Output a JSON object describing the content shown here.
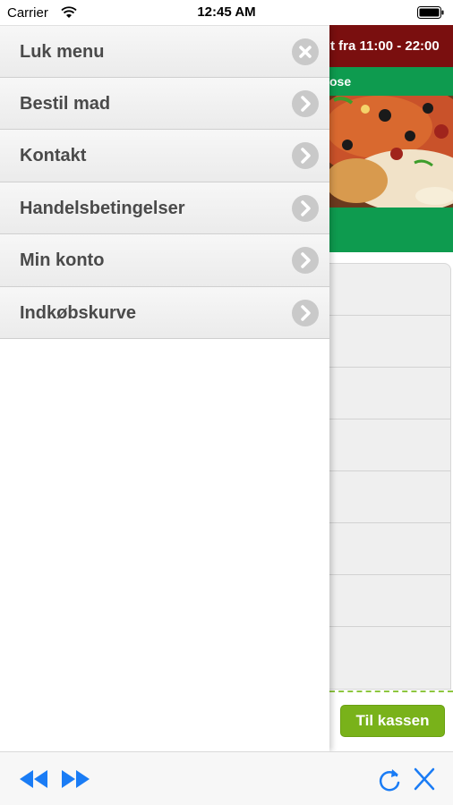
{
  "status_bar": {
    "carrier": "Carrier",
    "time": "12:45 AM"
  },
  "background_page": {
    "info_banner": "t fra 11:00 - 22:00",
    "green_caption": "ose",
    "checkout_button": "Til kassen",
    "colors": {
      "banner": "#7a0f0f",
      "green": "#0e9b4f",
      "checkout": "#79b21a"
    }
  },
  "menu": {
    "items": [
      {
        "label": "Luk menu",
        "icon": "close-icon"
      },
      {
        "label": "Bestil mad",
        "icon": "chevron-right-icon"
      },
      {
        "label": "Kontakt",
        "icon": "chevron-right-icon"
      },
      {
        "label": "Handelsbetingelser",
        "icon": "chevron-right-icon"
      },
      {
        "label": "Min konto",
        "icon": "chevron-right-icon"
      },
      {
        "label": "Indkøbskurve",
        "icon": "chevron-right-icon"
      }
    ]
  },
  "toolbar": {
    "icons": [
      "rewind-icon",
      "fast-forward-icon",
      "reload-icon",
      "close-icon"
    ],
    "accent": "#1a7cf5"
  }
}
